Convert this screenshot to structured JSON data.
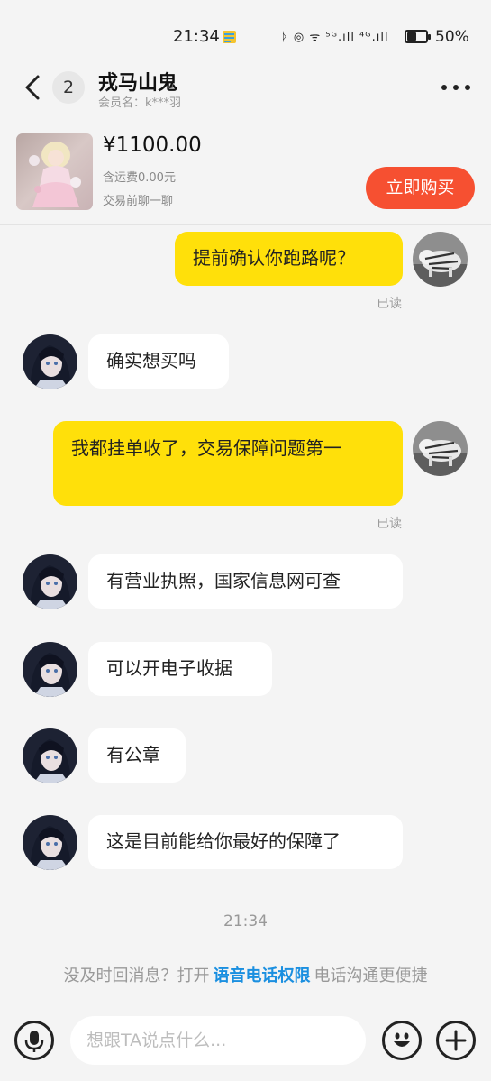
{
  "status": {
    "time": "21:34",
    "signal_icons": "ᚦ ◎ ᯤ ⁵ᴳ.ıll ⁴ᴳ.ıll",
    "battery_percent": "50%",
    "battery_level": 0.5
  },
  "header": {
    "unread_count": "2",
    "title": "戎马山鬼",
    "member_name": "会员名：k***羽"
  },
  "product": {
    "price": "¥1100.00",
    "shipping": "含运费0.00元",
    "pre_trade": "交易前聊一聊",
    "buy_button": "立即购买"
  },
  "messages": [
    {
      "from": "me",
      "text": "提前确认你跑路呢？",
      "status": "已读"
    },
    {
      "from": "them",
      "text": "确实想买吗"
    },
    {
      "from": "me",
      "text": "我都挂单收了，交易保障问题第一",
      "status": "已读"
    },
    {
      "from": "them",
      "text": "有营业执照，国家信息网可查"
    },
    {
      "from": "them",
      "text": "可以开电子收据"
    },
    {
      "from": "them",
      "text": "有公章"
    },
    {
      "from": "them",
      "text": "这是目前能给你最好的保障了"
    }
  ],
  "center_time": "21:34",
  "tip": {
    "prefix": "没及时回消息？打开",
    "link": "语音电话权限",
    "suffix": "电话沟通更便捷"
  },
  "input": {
    "placeholder": "想跟TA说点什么..."
  },
  "colors": {
    "my_bubble": "#ffe00a",
    "their_bubble": "#ffffff",
    "buy_button": "#f65031",
    "link": "#1a8fe0"
  }
}
